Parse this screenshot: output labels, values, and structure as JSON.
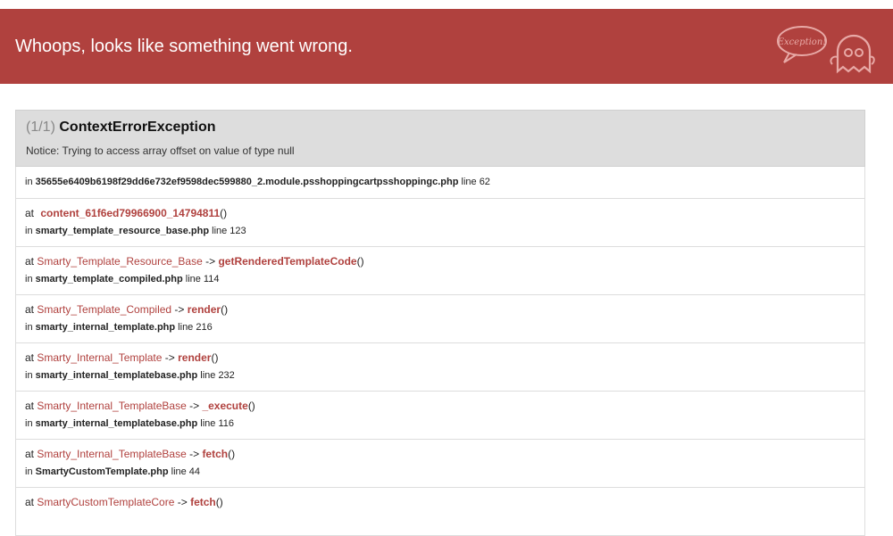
{
  "header": {
    "title": "Whoops, looks like something went wrong.",
    "logo_text": "Exception!"
  },
  "exception": {
    "count": "(1/1)",
    "class": "ContextErrorException",
    "message": "Notice: Trying to access array offset on value of type null"
  },
  "frames": [
    {
      "at_prefix": "",
      "cls": "",
      "arrow": "",
      "fn": "",
      "parens": "",
      "in_prefix": "in ",
      "file": "35655e6409b6198f29dd6e732ef9598dec599880_2.module.psshoppingcartpsshoppingc.php",
      "line": " line 62"
    },
    {
      "at_prefix": "at ",
      "cls": "",
      "arrow": "",
      "fn": "content_61f6ed79966900_14794811",
      "parens": "()",
      "in_prefix": "in ",
      "file": "smarty_template_resource_base.php",
      "line": " line 123"
    },
    {
      "at_prefix": "at ",
      "cls": "Smarty_Template_Resource_Base",
      "arrow": " -> ",
      "fn": "getRenderedTemplateCode",
      "parens": "()",
      "in_prefix": "in ",
      "file": "smarty_template_compiled.php",
      "line": " line 114"
    },
    {
      "at_prefix": "at ",
      "cls": "Smarty_Template_Compiled",
      "arrow": " -> ",
      "fn": "render",
      "parens": "()",
      "in_prefix": "in ",
      "file": "smarty_internal_template.php",
      "line": " line 216"
    },
    {
      "at_prefix": "at ",
      "cls": "Smarty_Internal_Template",
      "arrow": " -> ",
      "fn": "render",
      "parens": "()",
      "in_prefix": "in ",
      "file": "smarty_internal_templatebase.php",
      "line": " line 232"
    },
    {
      "at_prefix": "at ",
      "cls": "Smarty_Internal_TemplateBase",
      "arrow": " -> ",
      "fn": "_execute",
      "parens": "()",
      "in_prefix": "in ",
      "file": "smarty_internal_templatebase.php",
      "line": " line 116"
    },
    {
      "at_prefix": "at ",
      "cls": "Smarty_Internal_TemplateBase",
      "arrow": " -> ",
      "fn": "fetch",
      "parens": "()",
      "in_prefix": "in ",
      "file": "SmartyCustomTemplate.php",
      "line": " line 44"
    },
    {
      "at_prefix": "at ",
      "cls": "SmartyCustomTemplateCore",
      "arrow": " -> ",
      "fn": "fetch",
      "parens": "()",
      "in_prefix": "",
      "file": "",
      "line": ""
    }
  ]
}
